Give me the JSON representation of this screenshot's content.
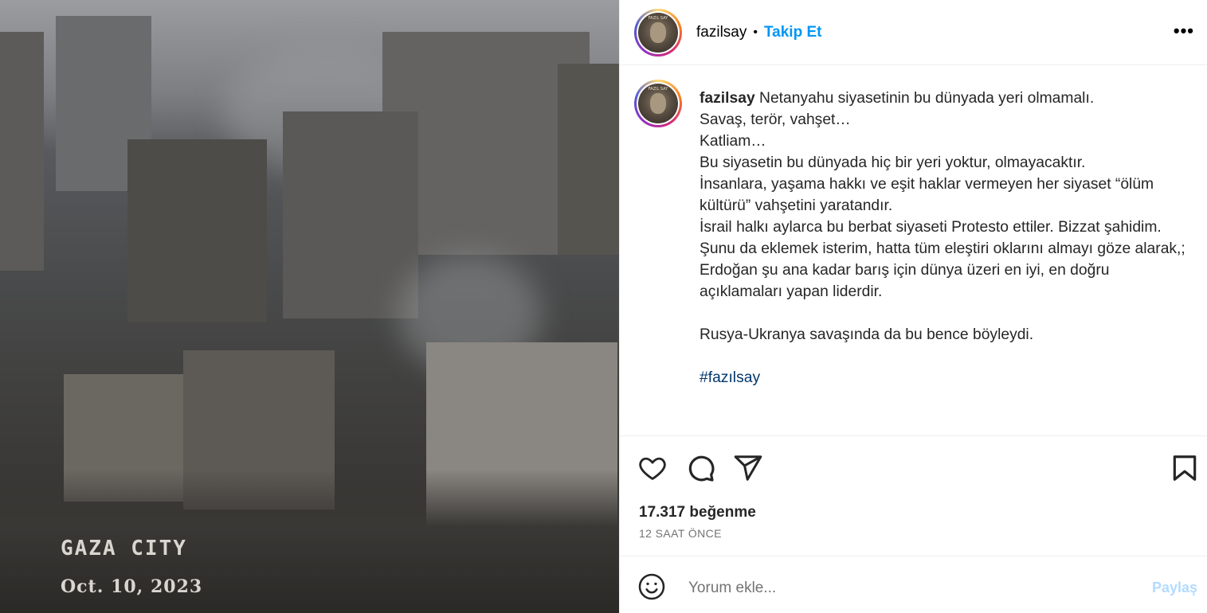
{
  "media": {
    "overlay_city": "GAZA CITY",
    "overlay_date": "Oct. 10, 2023"
  },
  "header": {
    "username": "fazilsay",
    "separator": "•",
    "follow_label": "Takip Et",
    "more_label": "•••",
    "avatar_text": "FAZIL SAY"
  },
  "caption": {
    "username": "fazilsay",
    "lines": [
      "Netanyahu siyasetinin bu dünyada yeri olmamalı.",
      "Savaş, terör, vahşet…",
      "Katliam…",
      "Bu siyasetin bu dünyada hiç bir yeri yoktur, olmayacaktır.",
      "İnsanlara, yaşama hakkı ve eşit haklar vermeyen her siyaset “ölüm kültürü” vahşetini yaratandır.",
      "İsrail halkı aylarca bu berbat siyaseti Protesto ettiler. Bizzat şahidim.",
      "Şunu da eklemek isterim, hatta tüm eleştiri oklarını almayı göze alarak,;",
      "Erdoğan şu ana kadar barış için dünya üzeri en iyi, en doğru açıklamaları yapan liderdir.",
      "",
      "Rusya-Ukranya savaşında da bu bence böyleydi.",
      ""
    ],
    "hashtag": "#fazılsay"
  },
  "actions": {
    "like_icon": "heart-icon",
    "comment_icon": "comment-icon",
    "share_icon": "paper-plane-icon",
    "save_icon": "bookmark-icon"
  },
  "stats": {
    "likes": "17.317 beğenme",
    "time": "12 SAAT ÖNCE"
  },
  "comment": {
    "placeholder": "Yorum ekle...",
    "share_label": "Paylaş",
    "emoji_icon": "smiley-icon"
  },
  "colors": {
    "accent": "#0095f6",
    "hashtag": "#00376b",
    "share_disabled": "#b3dbff"
  }
}
